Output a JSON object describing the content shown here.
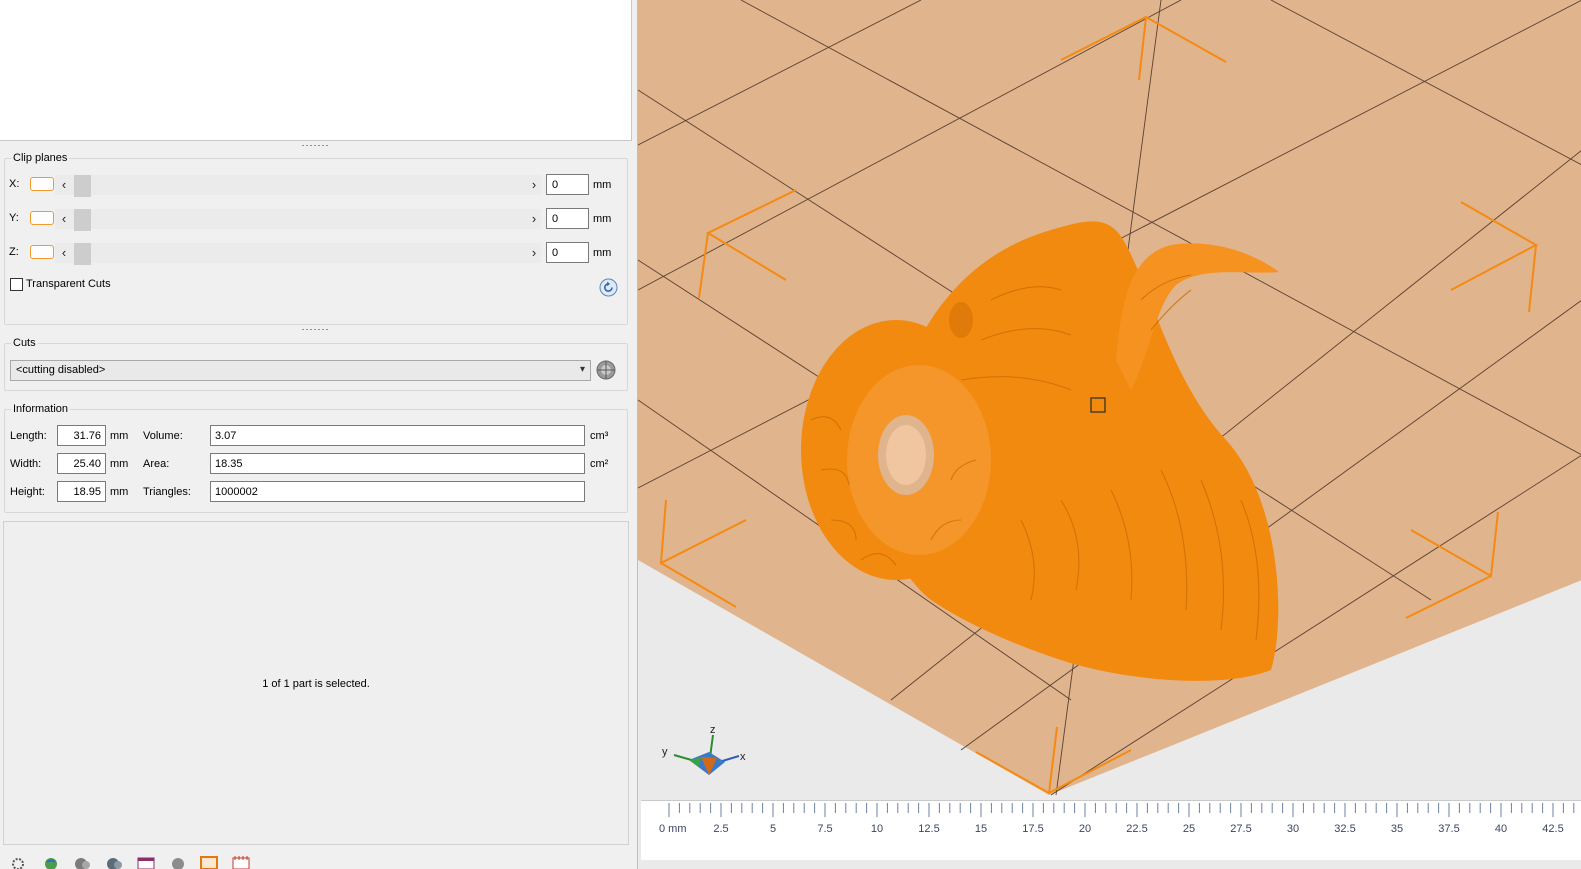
{
  "clip_planes": {
    "title": "Clip planes",
    "axes": [
      {
        "label": "X:",
        "value": "0",
        "unit": "mm"
      },
      {
        "label": "Y:",
        "value": "0",
        "unit": "mm"
      },
      {
        "label": "Z:",
        "value": "0",
        "unit": "mm"
      }
    ],
    "transparent_cuts_label": "Transparent Cuts",
    "transparent_cuts_checked": false
  },
  "cuts": {
    "title": "Cuts",
    "selected": "<cutting disabled>"
  },
  "information": {
    "title": "Information",
    "length_label": "Length:",
    "length_value": "31.76",
    "length_unit": "mm",
    "width_label": "Width:",
    "width_value": "25.40",
    "width_unit": "mm",
    "height_label": "Height:",
    "height_value": "18.95",
    "height_unit": "mm",
    "volume_label": "Volume:",
    "volume_value": "3.07",
    "volume_unit": "cm³",
    "area_label": "Area:",
    "area_value": "18.35",
    "area_unit": "cm²",
    "triangles_label": "Triangles:",
    "triangles_value": "1000002"
  },
  "selection_status": "1 of 1 part is selected.",
  "axis_gizmo": {
    "x": "x",
    "y": "y",
    "z": "z"
  },
  "ruler_labels": [
    "0 mm",
    "2.5",
    "5",
    "7.5",
    "10",
    "12.5",
    "15",
    "17.5",
    "20",
    "22.5",
    "25",
    "27.5",
    "30",
    "32.5",
    "35",
    "37.5",
    "40",
    "42.5"
  ],
  "toolbar_icons": [
    "settings-icon",
    "globe-icon",
    "sphere-icon",
    "sphere-dark-icon",
    "calendar-icon",
    "sphere-small-icon",
    "frame-icon",
    "calendar-red-icon"
  ],
  "colors": {
    "model": "#f58a13",
    "bed": "#e0b48c",
    "bounding_box": "#f58a13",
    "accent_toggle": "#f39a2e"
  }
}
